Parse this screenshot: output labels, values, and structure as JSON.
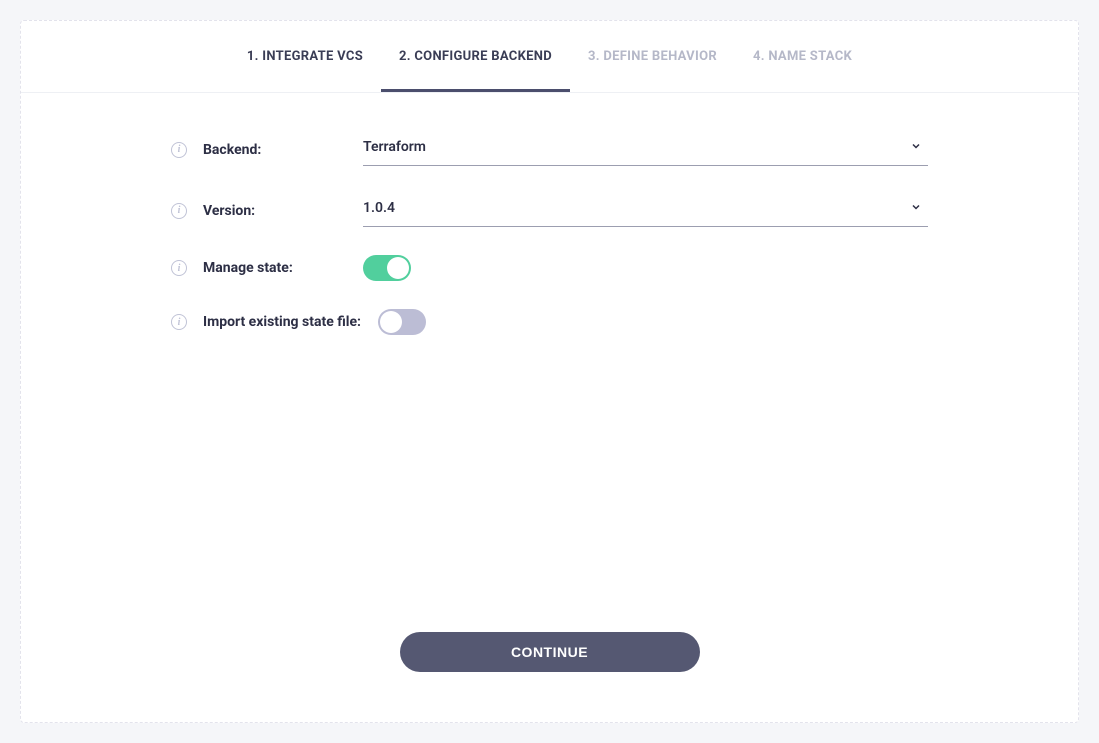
{
  "tabs": {
    "step1": "1. INTEGRATE VCS",
    "step2": "2. CONFIGURE BACKEND",
    "step3": "3. DEFINE BEHAVIOR",
    "step4": "4. NAME STACK"
  },
  "form": {
    "backend_label": "Backend:",
    "backend_value": "Terraform",
    "version_label": "Version:",
    "version_value": "1.0.4",
    "manage_state_label": "Manage state:",
    "manage_state_on": true,
    "import_state_label": "Import existing state file:",
    "import_state_on": false
  },
  "buttons": {
    "continue": "CONTINUE"
  },
  "icons": {
    "info_glyph": "i"
  }
}
